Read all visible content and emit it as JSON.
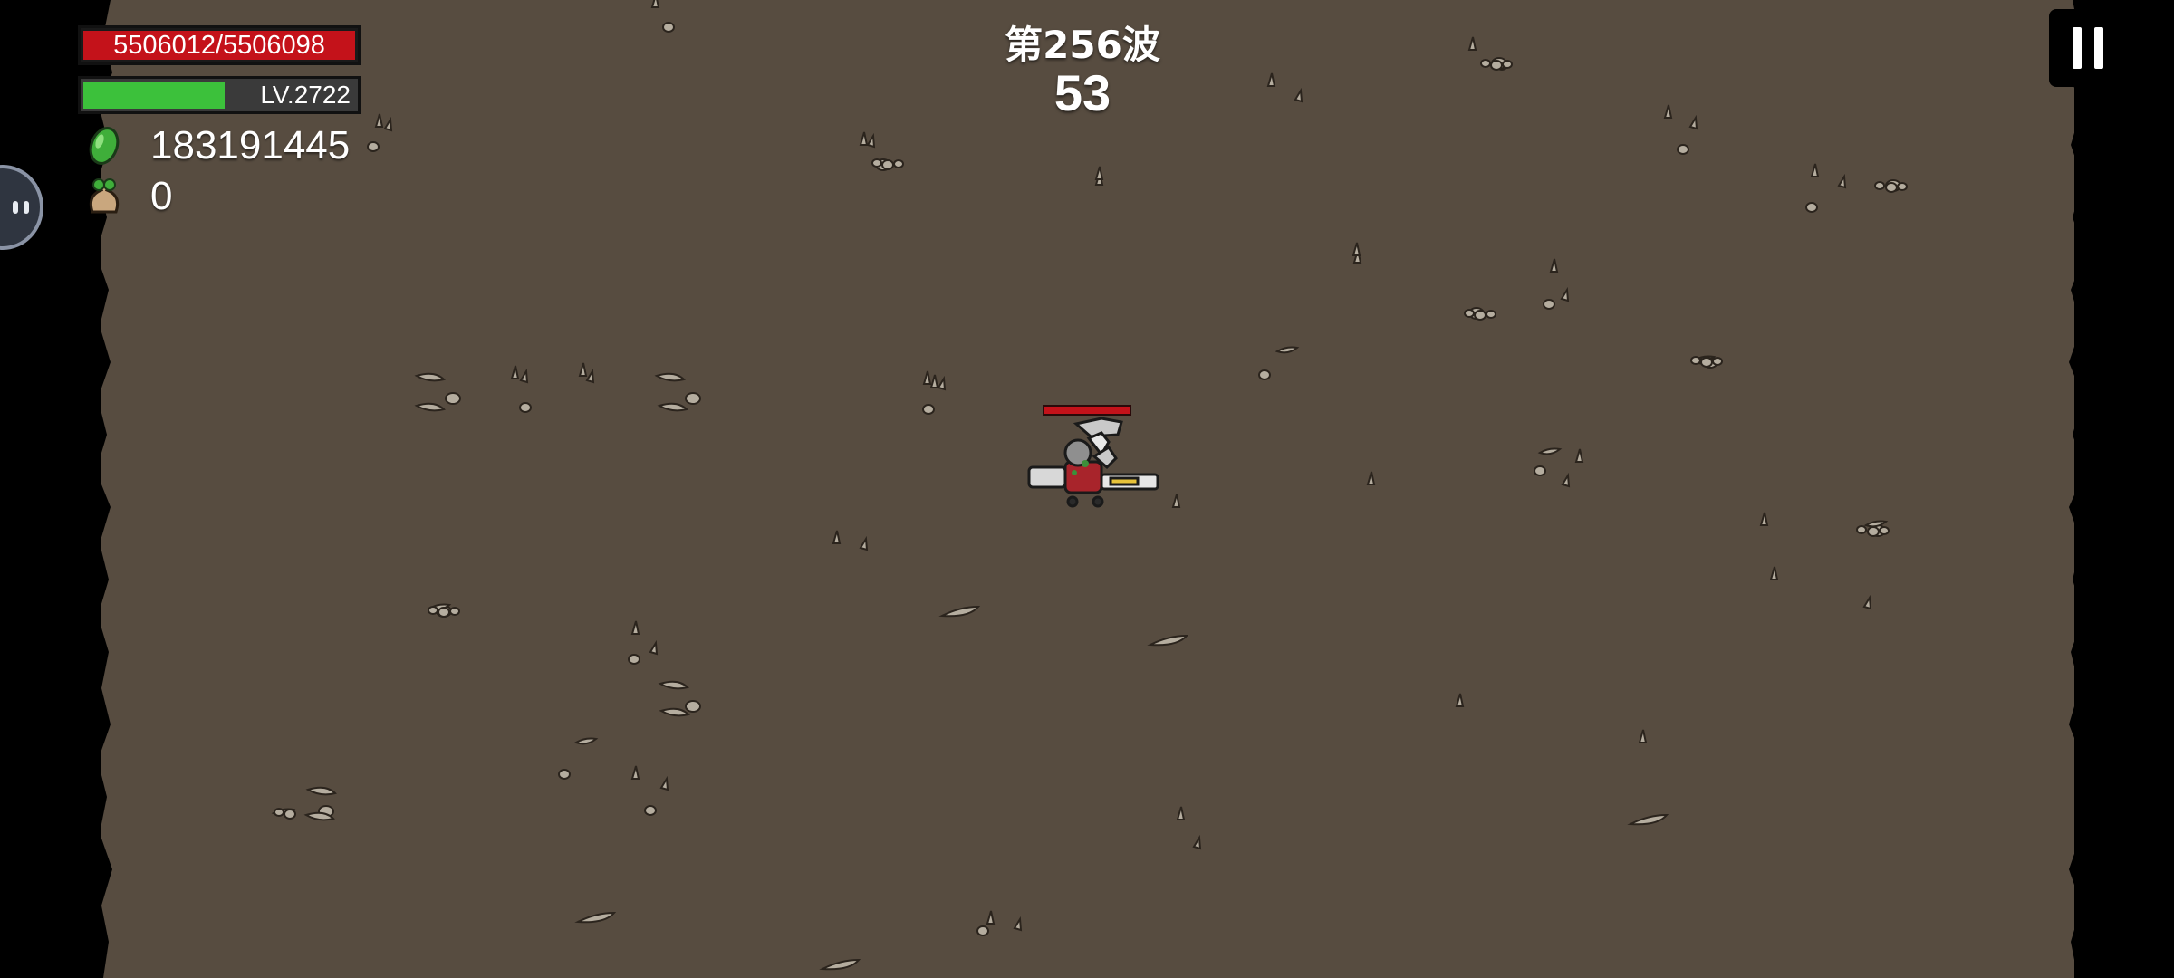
{
  "hud": {
    "hp_text": "5506012/5506098",
    "hp_fraction": 0.99998,
    "level_text": "LV.2722",
    "xp_fraction": 0.52,
    "gems": "183191445",
    "bags": "0"
  },
  "wave": {
    "title": "第256波",
    "timer": "53"
  },
  "colors": {
    "ground": "#574c40",
    "hp": "#c4121a",
    "xp": "#3cc13b"
  },
  "icons": {
    "gem": "green-gem-icon",
    "bag": "money-bag-icon",
    "pause": "pause-icon"
  }
}
